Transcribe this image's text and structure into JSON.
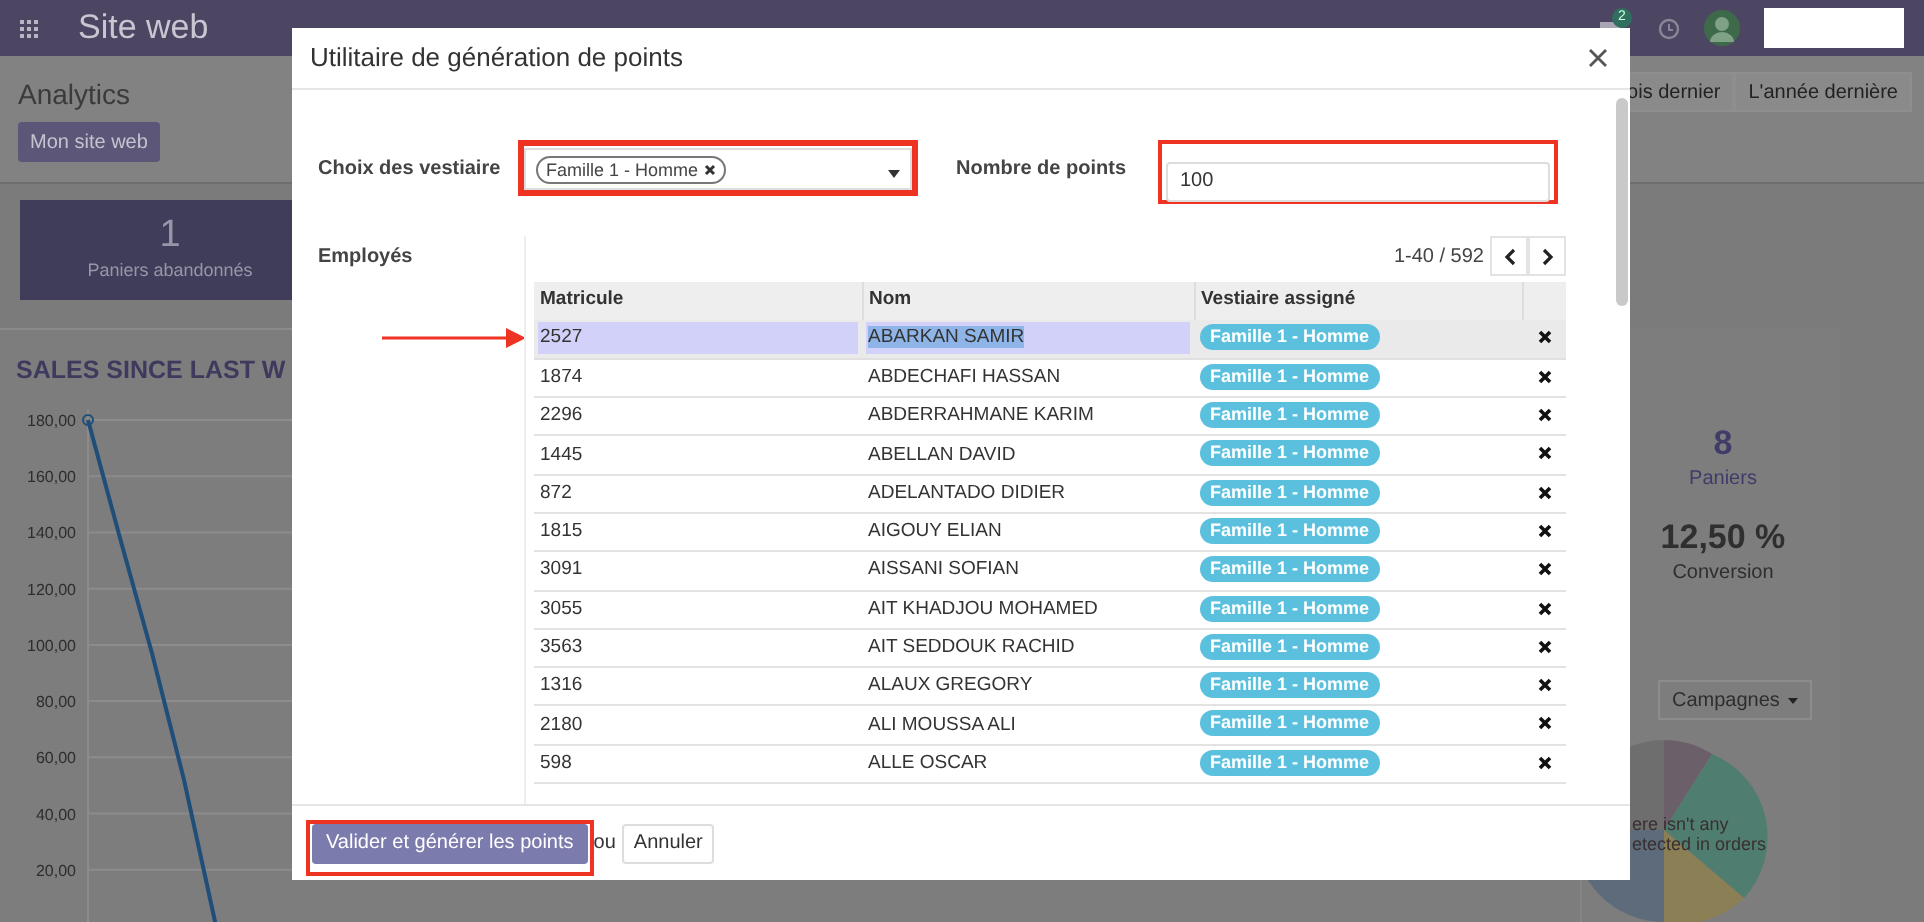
{
  "navbar": {
    "app_title": "Site web",
    "badge": "2"
  },
  "control_panel": {
    "title": "Analytics",
    "website_button": "Mon site web",
    "periods": [
      {
        "label": "ois dernier",
        "selected": false
      },
      {
        "label": "L'année dernière",
        "selected": false
      }
    ]
  },
  "stat": {
    "value": "1",
    "label": "Paniers abandonnés"
  },
  "sales_chart": {
    "title": "SALES SINCE LAST W",
    "chart_data": {
      "type": "line",
      "grid": true,
      "series": [
        {
          "color": "#1f4e79",
          "values": [
            180,
            138,
            97,
            52,
            0
          ]
        }
      ],
      "ylim": [
        0,
        180
      ],
      "yticks": [
        {
          "value": 180,
          "label": "180,00"
        },
        {
          "value": 160,
          "label": "160,00"
        },
        {
          "value": 140,
          "label": "140,00"
        },
        {
          "value": 120,
          "label": "120,00"
        },
        {
          "value": 100,
          "label": "100,00"
        },
        {
          "value": 80,
          "label": "80,00"
        },
        {
          "value": 60,
          "label": "60,00"
        },
        {
          "value": 40,
          "label": "40,00"
        },
        {
          "value": 20,
          "label": "20,00"
        }
      ]
    }
  },
  "summary": [
    {
      "value": "8",
      "label": "Paniers"
    },
    {
      "value": "12,50 %",
      "label": "Conversion"
    }
  ],
  "campaign_dropdown": "Campagnes",
  "pie_message": [
    "ere isn't any",
    "etected in orders"
  ],
  "dialog": {
    "title": "Utilitaire de génération de points",
    "vestiaire_label": "Choix des vestiaire",
    "vestiaire_tags": [
      "Famille 1 - Homme"
    ],
    "points_label": "Nombre de points",
    "points_value": "100",
    "employees_label": "Employés",
    "pager": "1-40 / 592",
    "columns": [
      "Matricule",
      "Nom",
      "Vestiaire assigné"
    ],
    "rows": [
      {
        "matricule": "2527",
        "nom": "ABARKAN SAMIR",
        "vestiaire": "Famille 1 - Homme",
        "selected": true
      },
      {
        "matricule": "1874",
        "nom": "ABDECHAFI HASSAN",
        "vestiaire": "Famille 1 - Homme",
        "selected": false
      },
      {
        "matricule": "2296",
        "nom": "ABDERRAHMANE KARIM",
        "vestiaire": "Famille 1 - Homme",
        "selected": false
      },
      {
        "matricule": "1445",
        "nom": "ABELLAN DAVID",
        "vestiaire": "Famille 1 - Homme",
        "selected": false
      },
      {
        "matricule": "872",
        "nom": "ADELANTADO DIDIER",
        "vestiaire": "Famille 1 - Homme",
        "selected": false
      },
      {
        "matricule": "1815",
        "nom": "AIGOUY ELIAN",
        "vestiaire": "Famille 1 - Homme",
        "selected": false
      },
      {
        "matricule": "3091",
        "nom": "AISSANI SOFIAN",
        "vestiaire": "Famille 1 - Homme",
        "selected": false
      },
      {
        "matricule": "3055",
        "nom": "AIT KHADJOU MOHAMED",
        "vestiaire": "Famille 1 - Homme",
        "selected": false
      },
      {
        "matricule": "3563",
        "nom": "AIT SEDDOUK RACHID",
        "vestiaire": "Famille 1 - Homme",
        "selected": false
      },
      {
        "matricule": "1316",
        "nom": "ALAUX GREGORY",
        "vestiaire": "Famille 1 - Homme",
        "selected": false
      },
      {
        "matricule": "2180",
        "nom": "ALI MOUSSA ALI",
        "vestiaire": "Famille 1 - Homme",
        "selected": false
      },
      {
        "matricule": "598",
        "nom": "ALLE OSCAR",
        "vestiaire": "Famille 1 - Homme",
        "selected": false
      }
    ],
    "submit_button": "Valider et générer les points",
    "or_text": "ou",
    "cancel_button": "Annuler"
  }
}
